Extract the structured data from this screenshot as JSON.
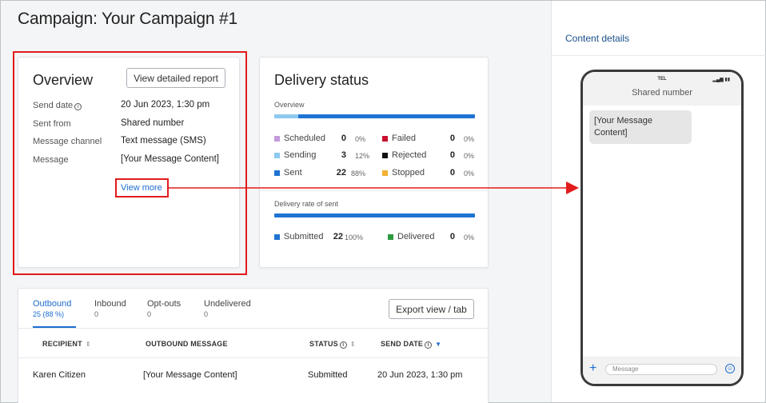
{
  "page": {
    "title": "Campaign: Your Campaign #1"
  },
  "overview": {
    "title": "Overview",
    "report_button": "View detailed report",
    "rows": [
      {
        "label": "Send date",
        "value": "20 Jun 2023, 1:30 pm",
        "info": true
      },
      {
        "label": "Sent from",
        "value": "Shared number"
      },
      {
        "label": "Message channel",
        "value": "Text message (SMS)"
      },
      {
        "label": "Message",
        "value": "[Your Message Content]"
      }
    ],
    "view_more": "View more",
    "info_icon": "i"
  },
  "delivery": {
    "title": "Delivery status",
    "overview_label": "Overview",
    "overview_progress_pct": 12,
    "items": [
      {
        "label": "Scheduled",
        "count": "0",
        "pct": "0%",
        "color": "#c39bdb"
      },
      {
        "label": "Sending",
        "count": "3",
        "pct": "12%",
        "color": "#8ec9ef"
      },
      {
        "label": "Sent",
        "count": "22",
        "pct": "88%",
        "color": "#1f74d2"
      },
      {
        "label": "Failed",
        "count": "0",
        "pct": "0%",
        "color": "#c8102e"
      },
      {
        "label": "Rejected",
        "count": "0",
        "pct": "0%",
        "color": "#111111"
      },
      {
        "label": "Stopped",
        "count": "0",
        "pct": "0%",
        "color": "#f2b233"
      }
    ],
    "rate_label": "Delivery rate of sent",
    "rate_items": [
      {
        "label": "Submitted",
        "count": "22",
        "pct": "100%",
        "color": "#1f74d2"
      },
      {
        "label": "Delivered",
        "count": "0",
        "pct": "0%",
        "color": "#2e9a3e"
      }
    ]
  },
  "messages": {
    "tabs": [
      {
        "label": "Outbound",
        "count": "25 (88 %)"
      },
      {
        "label": "Inbound",
        "count": "0"
      },
      {
        "label": "Opt-outs",
        "count": "0"
      },
      {
        "label": "Undelivered",
        "count": "0"
      }
    ],
    "export_button": "Export view / tab",
    "columns": [
      "RECIPIENT",
      "OUTBOUND MESSAGE",
      "STATUS",
      "SEND DATE"
    ],
    "rows": [
      {
        "recipient": "Karen Citizen",
        "message": "[Your Message Content]",
        "status": "Submitted",
        "send_date": "20 Jun 2023, 1:30 pm"
      }
    ],
    "sort_icon": "⇕",
    "sort_active_icon": "▼"
  },
  "content_details": {
    "title": "Content details",
    "phone": {
      "carrier": "TEL",
      "status": "▂▄▆ ▮▮",
      "contact": "Shared number",
      "bubble": "[Your Message Content]",
      "input_placeholder": "Message",
      "plus": "+",
      "smile": "☺"
    }
  },
  "colors": {
    "accent": "#1c6dd0",
    "highlight": "#e21b1b",
    "bar": "#1f74d2",
    "bar_light": "#8ec9ef"
  }
}
